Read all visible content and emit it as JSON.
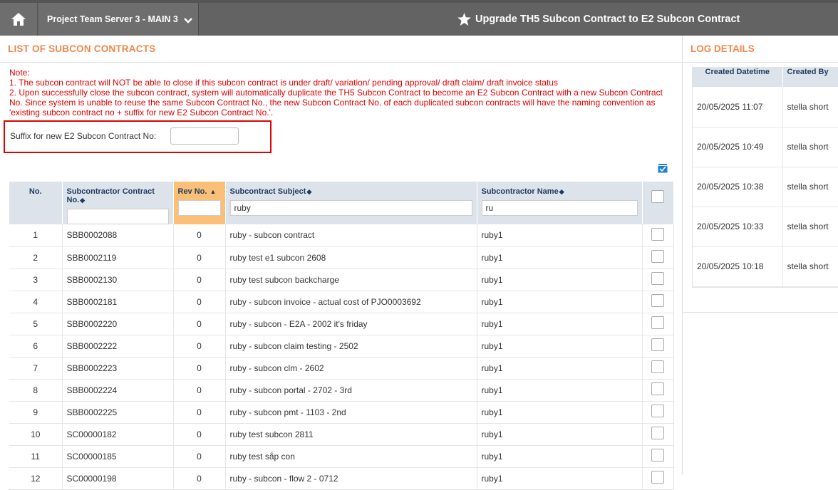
{
  "header": {
    "server_label": "Project Team Server 3 - MAIN 3",
    "title": "Upgrade TH5 Subcon Contract to E2 Subcon Contract",
    "home_icon": "home-icon",
    "title_icon": "star-icon"
  },
  "list": {
    "heading": "LIST OF SUBCON CONTRACTS",
    "note_lines": [
      "Note:",
      "1. The subcon contract will NOT be able to close if this subcon contract is under draft/ variation/ pending approval/ draft claim/ draft invoice status",
      "2. Upon successfully close the subcon contract, system will automatically duplicate the TH5 Subcon Contract to become an E2 Subcon Contract with a new Subcon Contract No. Since system is unable to reuse the same Subcon Contract No., the new Subcon Contract No. of each duplicated subcon contracts will have the naming convention as 'existing subcon contract no + suffix for new E2 Subcon Contract No.'."
    ],
    "suffix_label": "Suffix for new E2 Subcon Contract No:",
    "suffix_value": "",
    "columns": {
      "no": "No.",
      "contract_no": "Subcontractor Contract No.",
      "rev_no": "Rev No.",
      "subject": "Subcontract Subject",
      "name": "Subcontractor Name"
    },
    "filters": {
      "contract_no": "",
      "rev_no": "",
      "subject": "ruby",
      "name": "ru"
    },
    "rows": [
      {
        "no": "1",
        "contract_no": "SBB0002088",
        "rev": "0",
        "subject": "ruby - subcon contract",
        "name": "ruby1"
      },
      {
        "no": "2",
        "contract_no": "SBB0002119",
        "rev": "0",
        "subject": "ruby test e1 subcon 2608",
        "name": "ruby1"
      },
      {
        "no": "3",
        "contract_no": "SBB0002130",
        "rev": "0",
        "subject": "ruby test subcon backcharge",
        "name": "ruby1"
      },
      {
        "no": "4",
        "contract_no": "SBB0002181",
        "rev": "0",
        "subject": "ruby - subcon invoice - actual cost of PJO0003692",
        "name": "ruby1"
      },
      {
        "no": "5",
        "contract_no": "SBB0002220",
        "rev": "0",
        "subject": "ruby - subcon - E2A - 2002 it's friday",
        "name": "ruby1"
      },
      {
        "no": "6",
        "contract_no": "SBB0002222",
        "rev": "0",
        "subject": "ruby - subcon claim testing - 2502",
        "name": "ruby1"
      },
      {
        "no": "7",
        "contract_no": "SBB0002223",
        "rev": "0",
        "subject": "ruby - subcon clm - 2602",
        "name": "ruby1"
      },
      {
        "no": "8",
        "contract_no": "SBB0002224",
        "rev": "0",
        "subject": "ruby - subcon portal - 2702 - 3rd",
        "name": "ruby1"
      },
      {
        "no": "9",
        "contract_no": "SBB0002225",
        "rev": "0",
        "subject": "ruby - subcon pmt - 1103 - 2nd",
        "name": "ruby1"
      },
      {
        "no": "10",
        "contract_no": "SC00000182",
        "rev": "0",
        "subject": "ruby test subcon 2811",
        "name": "ruby1"
      },
      {
        "no": "11",
        "contract_no": "SC00000185",
        "rev": "0",
        "subject": "ruby test sắp con",
        "name": "ruby1"
      },
      {
        "no": "12",
        "contract_no": "SC00000198",
        "rev": "0",
        "subject": "ruby - subcon - flow 2 - 0712",
        "name": "ruby1"
      }
    ]
  },
  "log": {
    "heading": "LOG DETAILS",
    "columns": {
      "datetime": "Created Datetime",
      "by": "Created By"
    },
    "rows": [
      {
        "datetime": "20/05/2025 11:07",
        "by": "stella short"
      },
      {
        "datetime": "20/05/2025 10:49",
        "by": "stella short"
      },
      {
        "datetime": "20/05/2025 10:38",
        "by": "stella short"
      },
      {
        "datetime": "20/05/2025 10:33",
        "by": "stella short"
      },
      {
        "datetime": "20/05/2025 10:18",
        "by": "stella short"
      }
    ]
  },
  "colors": {
    "topbar": "#636363",
    "accent_heading": "#f0874a",
    "note_red": "#e00000",
    "sorted_header": "#fbbf78",
    "header_bg": "#dde3eb"
  }
}
